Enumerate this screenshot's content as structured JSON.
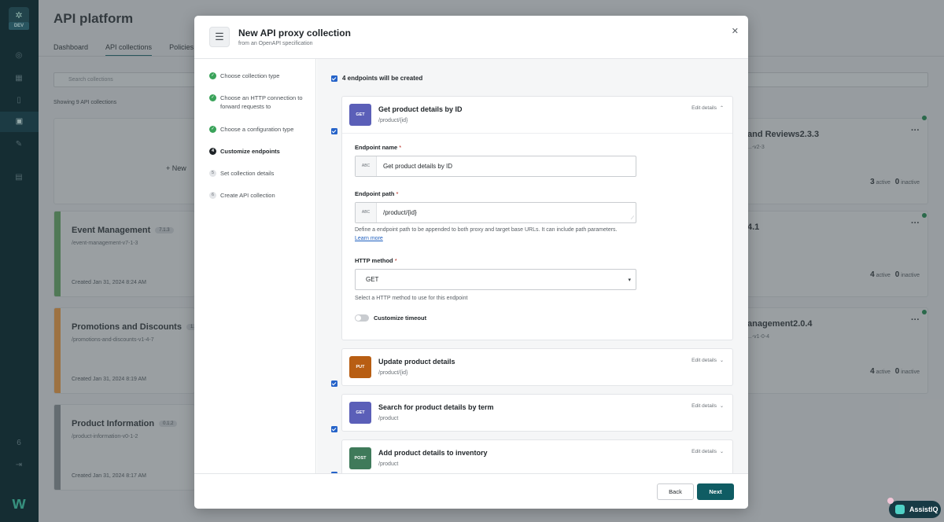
{
  "app": {
    "env_badge": "DEV",
    "page_title": "API platform",
    "tabs": [
      "Dashboard",
      "API collections",
      "Policies"
    ],
    "search_placeholder": "Search collections",
    "showing_text": "Showing 9 API collections",
    "new_label": "New",
    "counter_badge": "6"
  },
  "bg_cards": [
    {
      "name": "Event Management",
      "version": "7.1.3",
      "path": "/event-management-v7-1-3",
      "created": "Created Jan 31, 2024 8:24 AM",
      "color": "#6aa56a"
    },
    {
      "name": "Promotions and Discounts",
      "version": "1.4",
      "path": "/promotions-and-discounts-v1-4-7",
      "created": "Created Jan 31, 2024 8:19 AM",
      "color": "#e69a4a"
    },
    {
      "name": "Product Information",
      "version": "0.1.2",
      "path": "/product-information-v0-1-2",
      "created": "Created Jan 31, 2024 8:17 AM",
      "color": "#8a9095"
    }
  ],
  "right_cards": [
    {
      "name": "and Reviews",
      "version": "2.3.3",
      "path": "...-v2-3",
      "active": "3",
      "inactive": "0"
    },
    {
      "name": "",
      "version": "4.1",
      "path": "",
      "active": "4",
      "inactive": "0"
    },
    {
      "name": "anagement",
      "version": "2.0.4",
      "path": "...-v1-0-4",
      "active": "4",
      "inactive": "0"
    }
  ],
  "stats_labels": {
    "active": "active",
    "inactive": "inactive"
  },
  "assist": {
    "label": "AssistIQ"
  },
  "modal": {
    "title": "New API proxy collection",
    "subtitle": "from an OpenAPI specification",
    "steps": [
      {
        "num": "1",
        "label": "Choose collection type",
        "state": "done"
      },
      {
        "num": "2",
        "label": "Choose an HTTP connection to forward requests to",
        "state": "done"
      },
      {
        "num": "3",
        "label": "Choose a configuration type",
        "state": "done"
      },
      {
        "num": "4",
        "label": "Customize endpoints",
        "state": "current"
      },
      {
        "num": "5",
        "label": "Set collection details",
        "state": "todo"
      },
      {
        "num": "6",
        "label": "Create API collection",
        "state": "todo"
      }
    ],
    "endpoints_header": "4 endpoints will be created",
    "edit_details": "Edit details",
    "endpoints": [
      {
        "method": "GET",
        "name": "Get product details by ID",
        "path": "/product/{id}",
        "color": "#5b5fb8"
      },
      {
        "method": "PUT",
        "name": "Update product details",
        "path": "/product/{id}",
        "color": "#b85e13"
      },
      {
        "method": "GET",
        "name": "Search for product details by term",
        "path": "/product",
        "color": "#5b5fb8"
      },
      {
        "method": "POST",
        "name": "Add product details to inventory",
        "path": "/product",
        "color": "#3f7a5a"
      }
    ],
    "form": {
      "name_label": "Endpoint name",
      "name_value": "Get product details by ID",
      "path_label": "Endpoint path",
      "path_value": "/product/{id}",
      "path_help": "Define a endpoint path to be appended to both proxy and target base URLs. It can include path parameters.",
      "learn_more": "Learn more",
      "method_label": "HTTP method",
      "method_value": "GET",
      "method_help": "Select a HTTP method to use for this endpoint",
      "timeout_label": "Customize timeout",
      "abc": "ABC",
      "required_mark": "*"
    },
    "buttons": {
      "back": "Back",
      "next": "Next"
    }
  }
}
